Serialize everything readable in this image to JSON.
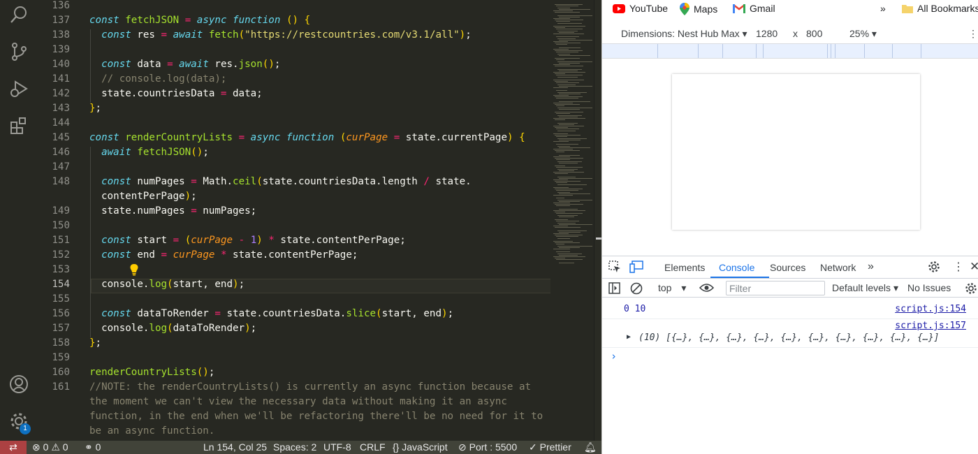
{
  "editor": {
    "lines": [
      {
        "n": "136",
        "code": ""
      },
      {
        "n": "137",
        "code": "const fetchJSON = async function () {"
      },
      {
        "n": "138",
        "code": "  const res = await fetch(\"https://restcountries.com/v3.1/all\");"
      },
      {
        "n": "139",
        "code": ""
      },
      {
        "n": "140",
        "code": "  const data = await res.json();"
      },
      {
        "n": "141",
        "code": "  // console.log(data);"
      },
      {
        "n": "142",
        "code": "  state.countriesData = data;"
      },
      {
        "n": "143",
        "code": "};"
      },
      {
        "n": "144",
        "code": ""
      },
      {
        "n": "145",
        "code": "const renderCountryLists = async function (curPage = state.currentPage) {"
      },
      {
        "n": "146",
        "code": "  await fetchJSON();"
      },
      {
        "n": "147",
        "code": ""
      },
      {
        "n": "148",
        "code": "  const numPages = Math.ceil(state.countriesData.length / state."
      },
      {
        "n": "",
        "code": "contentPerPage);"
      },
      {
        "n": "149",
        "code": "  state.numPages = numPages;"
      },
      {
        "n": "150",
        "code": ""
      },
      {
        "n": "151",
        "code": "  const start = (curPage - 1) * state.contentPerPage;"
      },
      {
        "n": "152",
        "code": "  const end = curPage * state.contentPerPage;"
      },
      {
        "n": "153",
        "code": ""
      },
      {
        "n": "154",
        "code": "  console.log(start, end);"
      },
      {
        "n": "155",
        "code": ""
      },
      {
        "n": "156",
        "code": "  const dataToRender = state.countriesData.slice(start, end);"
      },
      {
        "n": "157",
        "code": "  console.log(dataToRender);"
      },
      {
        "n": "158",
        "code": "};"
      },
      {
        "n": "159",
        "code": ""
      },
      {
        "n": "160",
        "code": "renderCountryLists();"
      },
      {
        "n": "161",
        "code": "//NOTE: the renderCountryLists() is currently an async function because at"
      },
      {
        "n": "",
        "code": "the moment we can't view the necessary data without making it an async"
      },
      {
        "n": "",
        "code": "function, in the end when we'll be refactoring there'll be no need for it to"
      },
      {
        "n": "",
        "code": "be an async function."
      }
    ],
    "active_line": "154"
  },
  "activity_bar": {
    "icons": [
      "search-icon",
      "source-control-icon",
      "run-debug-icon",
      "extensions-icon",
      "account-icon",
      "settings-gear-icon"
    ],
    "settings_badge": "1"
  },
  "status_bar": {
    "remote_icon": "remote-icon",
    "errors": "0",
    "warnings": "0",
    "ports": "0",
    "cursor": "Ln 154, Col 25",
    "spaces": "Spaces: 2",
    "encoding": "UTF-8",
    "eol": "CRLF",
    "language": "JavaScript",
    "live_server": "Port : 5500",
    "prettier": "Prettier"
  },
  "browser": {
    "bookmarks": [
      {
        "label": "YouTube",
        "icon": "youtube-icon"
      },
      {
        "label": "Maps",
        "icon": "maps-icon"
      },
      {
        "label": "Gmail",
        "icon": "gmail-icon"
      }
    ],
    "more_bookmarks": "»",
    "all_bookmarks": "All Bookmarks",
    "device_toolbar": {
      "dimensions": "Dimensions: Nest Hub Max",
      "width": "1280",
      "times": "x",
      "height": "800",
      "zoom": "25%"
    }
  },
  "devtools": {
    "tabs": [
      "Elements",
      "Console",
      "Sources",
      "Network"
    ],
    "active_tab": "Console",
    "more_tabs": "»",
    "context": "top",
    "filter_placeholder": "Filter",
    "levels": "Default levels",
    "issues": "No Issues",
    "console_entries": [
      {
        "text": "0 10",
        "source": "script.js:154"
      },
      {
        "text": "(10) [{…}, {…}, {…}, {…}, {…}, {…}, {…}, {…}, {…}, {…}]",
        "source": "script.js:157"
      }
    ],
    "prompt": "›"
  },
  "colors": {
    "editor_bg": "#272822",
    "status_bg": "#414339",
    "remote_bg": "#ac4142",
    "keyword": "#66d9ef",
    "operator": "#f92672",
    "function": "#a6e22e",
    "string": "#e6db74",
    "parameter": "#fd971f",
    "number": "#ae81ff",
    "comment": "#88846f",
    "devtools_accent": "#1a73e8"
  }
}
